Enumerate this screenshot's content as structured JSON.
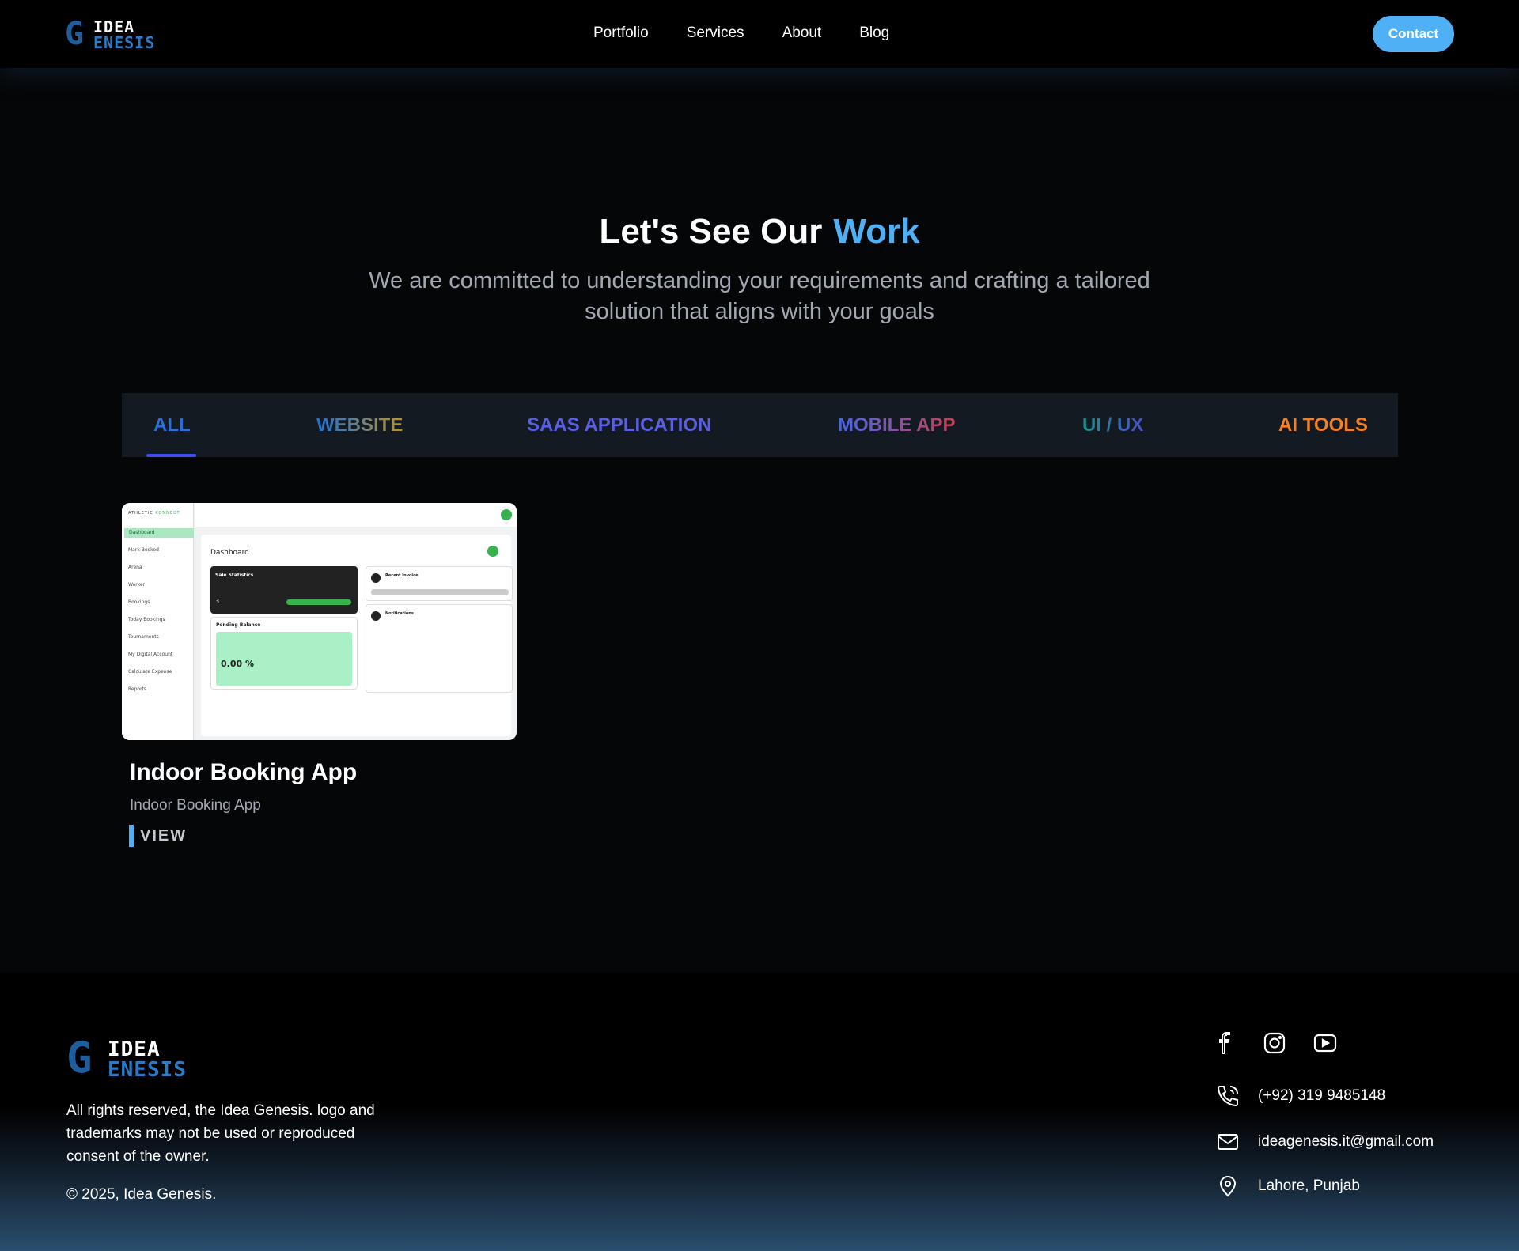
{
  "nav": {
    "logo": {
      "letter": "G",
      "line1": "IDEA",
      "line2": "ENESIS"
    },
    "links": [
      "Portfolio",
      "Services",
      "About",
      "Blog"
    ],
    "contact_label": "Contact"
  },
  "hero": {
    "title": "Let's See Our",
    "title_accent": "Work",
    "subtitle": "We are committed to understanding your requirements and crafting a tailored solution that aligns with your goals"
  },
  "tabs": {
    "items": [
      "ALL",
      "WEBSITE",
      "SAAS APPLICATION",
      "MOBILE APP",
      "UI / UX",
      "AI TOOLS"
    ],
    "active": "ALL"
  },
  "project": {
    "title": "Indoor Booking App",
    "subtitle": "Indoor Booking App",
    "view_label": "VIEW",
    "preview": {
      "brand": "ATHLETIC",
      "brand_accent": "KONNECT",
      "heading": "Dashboard",
      "nav_items": [
        "Dashboard",
        "Mark Booked",
        "Arena",
        "Worker",
        "Bookings",
        "Today Bookings",
        "Tournaments",
        "My Digital Account",
        "Calculate Expense",
        "Reports"
      ],
      "sale_statistics": "Sale Statistics",
      "sale_value": "3",
      "recent_invoice": "Recent Invoice",
      "notifications": "Notifications",
      "pending_balance": "Pending Balance",
      "pending_value": "0.00 %"
    }
  },
  "footer": {
    "logo": {
      "letter": "G",
      "line1": "IDEA",
      "line2": "ENESIS"
    },
    "rights": "All rights reserved, the Idea Genesis. logo and trademarks may not be used or reproduced consent of the owner.",
    "copyright": "© 2025, Idea Genesis.",
    "socials": [
      "facebook-icon",
      "instagram-icon",
      "youtube-icon"
    ],
    "phone": "(+92) 319 9485148",
    "email": "ideagenesis.it@gmail.com",
    "location": "Lahore, Punjab"
  },
  "colors": {
    "accent": "#4fb0f5",
    "background": "#050608"
  }
}
